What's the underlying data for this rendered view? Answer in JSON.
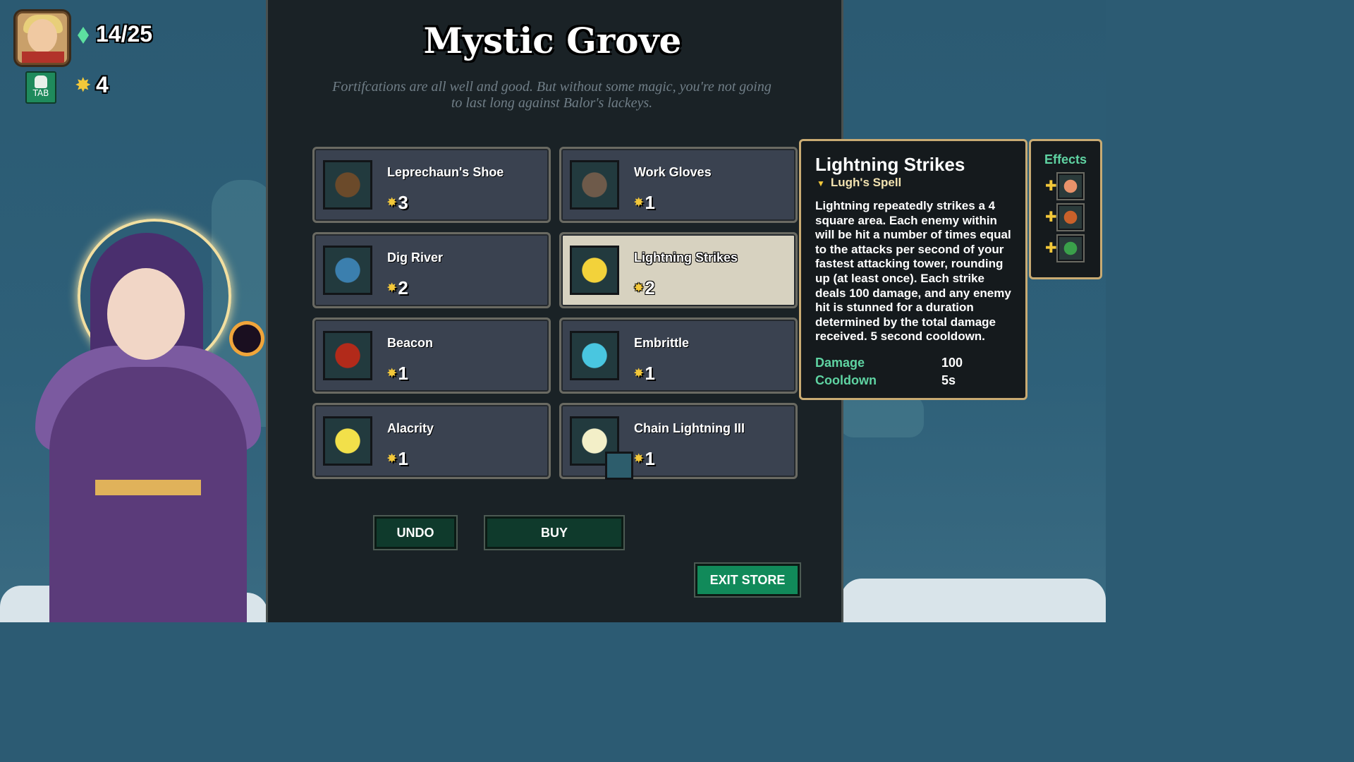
{
  "hud": {
    "gems": "14/25",
    "stars": "4",
    "tab_label": "TAB"
  },
  "store": {
    "title": "Mystic Grove",
    "subtitle": "Fortifcations are all well and good. But without some magic, you're not going to last long against Balor's lackeys."
  },
  "items": [
    {
      "name": "Leprechaun's Shoe",
      "cost": "3",
      "icon": "boot-icon",
      "color": "#6b4a2a"
    },
    {
      "name": "Work Gloves",
      "cost": "1",
      "icon": "glove-icon",
      "color": "#6e5a4a"
    },
    {
      "name": "Dig River",
      "cost": "2",
      "icon": "river-scroll-icon",
      "color": "#3b7fae"
    },
    {
      "name": "Lightning Strikes",
      "cost": "2",
      "icon": "lightning-icon",
      "color": "#f3d23a",
      "selected": true
    },
    {
      "name": "Beacon",
      "cost": "1",
      "icon": "beacon-tower-icon",
      "color": "#b22a1a"
    },
    {
      "name": "Embrittle",
      "cost": "1",
      "icon": "shield-icon",
      "color": "#49c6e0"
    },
    {
      "name": "Alacrity",
      "cost": "1",
      "icon": "alacrity-icon",
      "color": "#f2e04a"
    },
    {
      "name": "Chain Lightning III",
      "cost": "1",
      "icon": "chain-lightning-orb-icon",
      "color": "#f3efc8"
    }
  ],
  "buttons": {
    "undo": "UNDO",
    "buy": "BUY",
    "exit": "EXIT STORE"
  },
  "tooltip": {
    "title": "Lightning Strikes",
    "subtitle": "Lugh's Spell",
    "description": "Lightning repeatedly strikes a 4 square area. Each enemy within will  be hit a number of times equal to the attacks per second of your fastest attacking tower, rounding up (at least once). Each strike deals 100 damage, and any enemy hit is stunned for a duration determined by the total damage received. 5 second cooldown.",
    "stats": [
      {
        "label": "Damage",
        "value": "100"
      },
      {
        "label": "Cooldown",
        "value": "5s"
      }
    ]
  },
  "effects": {
    "title": "Effects",
    "items": [
      {
        "icon": "fist-icon",
        "color": "#e8926a"
      },
      {
        "icon": "crab-icon",
        "color": "#c9612a"
      },
      {
        "icon": "clover-icon",
        "color": "#3aa04a"
      }
    ]
  }
}
